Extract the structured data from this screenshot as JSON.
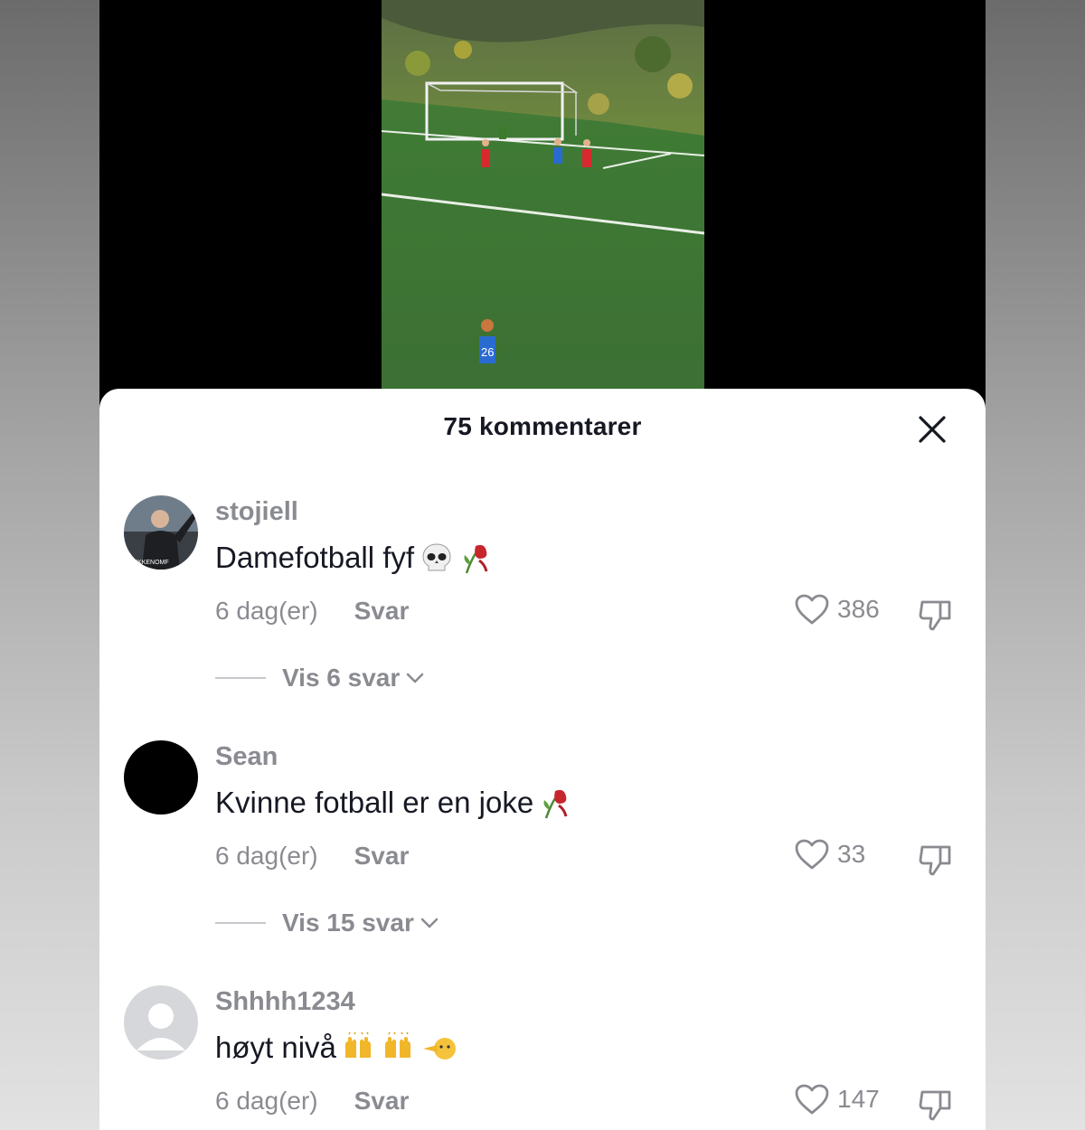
{
  "sheet": {
    "title": "75 kommentarer"
  },
  "icons": {
    "close": "close-icon",
    "like": "heart-icon",
    "dislike": "thumbs-down-icon",
    "chevron": "chevron-down-icon"
  },
  "colors": {
    "text": "#161823",
    "muted": "#8a8b91",
    "sheet_bg": "#ffffff",
    "video_bg": "#000000"
  },
  "video": {
    "jersey_number": "26"
  },
  "comments": [
    {
      "username": "stojiell",
      "text": "Damefotball fyf",
      "emojis": [
        "skull-emoji",
        "wilted-rose-emoji"
      ],
      "time": "6 dag(er)",
      "reply": "Svar",
      "likes": "386",
      "view_replies": "Vis 6 svar",
      "avatar_text": "UKKENOMF"
    },
    {
      "username": "Sean",
      "text": "Kvinne fotball er en joke",
      "emojis": [
        "wilted-rose-emoji"
      ],
      "time": "6 dag(er)",
      "reply": "Svar",
      "likes": "33",
      "view_replies": "Vis 15 svar"
    },
    {
      "username": "Shhhh1234",
      "text": "høyt nivå",
      "emojis": [
        "raising-hands-emoji",
        "raising-hands-emoji",
        "pointing-left-emoji"
      ],
      "time": "6 dag(er)",
      "reply": "Svar",
      "likes": "147"
    }
  ]
}
